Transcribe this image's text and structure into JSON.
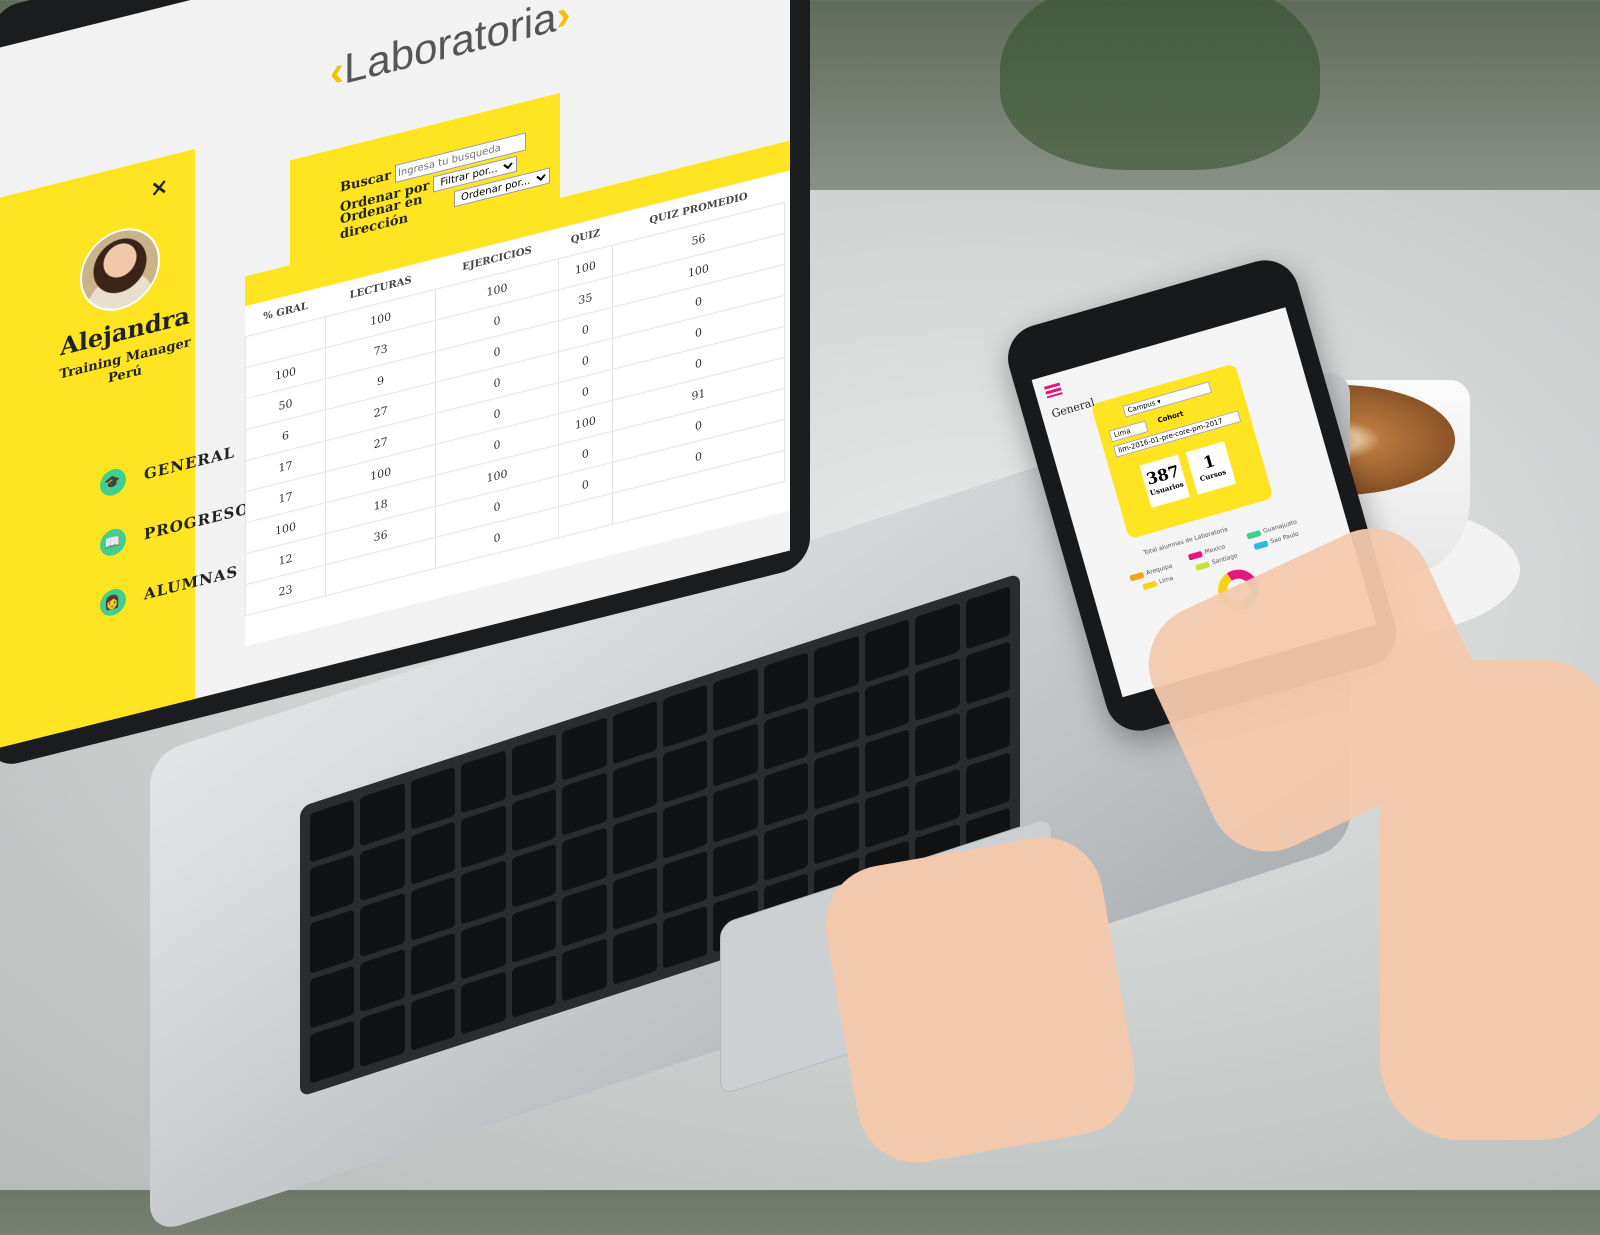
{
  "brand": {
    "logo_text": "Laboratoria",
    "accent": "#ffe521",
    "magenta": "#e5177f"
  },
  "sidebar": {
    "close_label": "×",
    "profile": {
      "name": "Alejandra",
      "role": "Training Manager",
      "location": "Perú"
    },
    "items": [
      {
        "label": "GENERAL",
        "icon": "graduation-cap-icon",
        "icon_color": "#3fcf8e"
      },
      {
        "label": "PROGRESO",
        "icon": "book-icon",
        "icon_color": "#3fcf8e"
      },
      {
        "label": "ALUMNAS",
        "icon": "student-icon",
        "icon_color": "#3fcf8e"
      }
    ]
  },
  "search": {
    "buscar_label": "Buscar",
    "buscar_placeholder": "Ingresa tu busqueda",
    "ordenar_label": "Ordenar por",
    "ordenar_value": "Filtrar por...",
    "direccion_label": "Ordenar en dirección",
    "direccion_value": "Ordenar por..."
  },
  "table": {
    "columns": [
      "% GRAL",
      "LECTURAS",
      "EJERCICIOS",
      "QUIZ",
      "QUIZ PROMEDIO"
    ],
    "header_values": [
      "",
      "100",
      "100",
      "100",
      "56"
    ],
    "rows": [
      [
        "100",
        "73",
        "0",
        "35",
        "100"
      ],
      [
        "50",
        "9",
        "0",
        "0",
        "0"
      ],
      [
        "6",
        "27",
        "0",
        "0",
        "0"
      ],
      [
        "17",
        "27",
        "0",
        "0",
        "0"
      ],
      [
        "17",
        "100",
        "0",
        "100",
        "91"
      ],
      [
        "100",
        "18",
        "100",
        "0",
        "0"
      ],
      [
        "12",
        "36",
        "0",
        "0",
        "0"
      ],
      [
        "23",
        "",
        "0",
        "",
        ""
      ]
    ]
  },
  "phone": {
    "title": "General",
    "campus_select": "Campus",
    "city_value": "Lima",
    "cohort_label": "Cohort",
    "cohort_value": "lim-2016-01-pre-core-pm-2017",
    "stats": [
      {
        "value": "387",
        "label": "Usuarios"
      },
      {
        "value": "1",
        "label": "Cursos"
      }
    ],
    "chart_caption": "Total alumnas de Laboratoria",
    "legend": [
      {
        "label": "Arequipa",
        "color": "#f7a21b"
      },
      {
        "label": "Mexico",
        "color": "#e5177f"
      },
      {
        "label": "Guanajuato",
        "color": "#3fcf8e"
      },
      {
        "label": "Lima",
        "color": "#f7d21b"
      },
      {
        "label": "Santiago",
        "color": "#c6e33a"
      },
      {
        "label": "Sao Paulo",
        "color": "#2fb8e6"
      }
    ]
  }
}
